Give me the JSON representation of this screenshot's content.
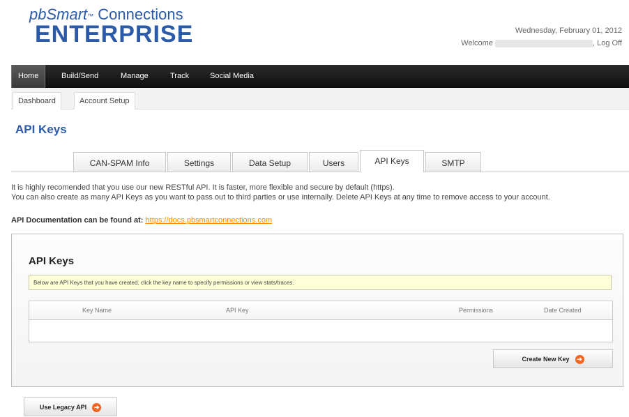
{
  "brand": {
    "top_prefix": "pb",
    "top_main": "Smart",
    "top_mark": "™",
    "top_suffix": " Connections",
    "bottom": "ENTERPRISE"
  },
  "header": {
    "date": "Wednesday, February 01, 2012",
    "welcome_label": "Welcome",
    "logoff_label": ", Log Off"
  },
  "nav": {
    "items": [
      {
        "label": "Home",
        "active": true
      },
      {
        "label": "Build/Send",
        "active": false
      },
      {
        "label": "Manage",
        "active": false
      },
      {
        "label": "Track",
        "active": false
      },
      {
        "label": "Social Media",
        "active": false
      }
    ]
  },
  "subnav": {
    "items": [
      {
        "label": "Dashboard"
      },
      {
        "label": "Account Setup"
      }
    ]
  },
  "page": {
    "title": "API Keys"
  },
  "tabs": [
    {
      "label": "CAN-SPAM Info",
      "active": false
    },
    {
      "label": "Settings",
      "active": false
    },
    {
      "label": "Data Setup",
      "active": false
    },
    {
      "label": "Users",
      "active": false
    },
    {
      "label": "API Keys",
      "active": true
    },
    {
      "label": "SMTP",
      "active": false
    }
  ],
  "intro": {
    "line1": "It is highly recomended that you use our new RESTful API. It is faster, more flexible and secure by default (https).",
    "line2": "You can also create as many API Keys as you want to pass out to third parties or use internally. Delete API Keys at any time to remove access to your account."
  },
  "docs": {
    "label": "API Documentation can be found at:",
    "link": "https://docs.pbsmartconnections.com"
  },
  "panel": {
    "title": "API Keys",
    "notice": "Below are API Keys that you have created, click the key name to specify permissions or view stats/traces.",
    "columns": [
      "Key Name",
      "API Key",
      "Permissions",
      "Date Created"
    ],
    "create_button": "Create New Key"
  },
  "legacy_button": "Use Legacy API",
  "colors": {
    "brand_blue": "#2a5aa8",
    "nav_bg": "#141414",
    "link_orange": "#ff8c00",
    "button_arrow": "#f26522",
    "notice_bg": "#ffffd8"
  },
  "icons": {
    "button_arrow": "arrow-right-circle-icon"
  }
}
